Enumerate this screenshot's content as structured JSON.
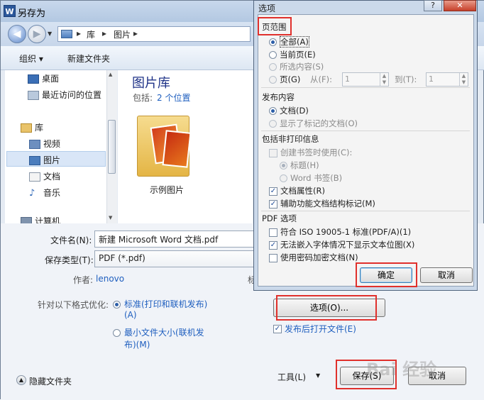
{
  "window": {
    "app_icon": "W",
    "title": "另存为"
  },
  "nav": {
    "breadcrumb": [
      "库",
      "图片"
    ]
  },
  "toolbar": {
    "organize": "组织 ▾",
    "new_folder": "新建文件夹"
  },
  "sidebar": {
    "items": [
      {
        "label": "桌面",
        "icon": "desktop-icon"
      },
      {
        "label": "最近访问的位置",
        "icon": "recent-places-icon"
      },
      {
        "label": "库",
        "icon": "library-icon"
      },
      {
        "label": "视频",
        "icon": "video-icon"
      },
      {
        "label": "图片",
        "icon": "pictures-icon"
      },
      {
        "label": "文档",
        "icon": "documents-icon"
      },
      {
        "label": "音乐",
        "icon": "music-icon"
      },
      {
        "label": "计算机",
        "icon": "computer-icon"
      }
    ]
  },
  "library": {
    "title": "图片库",
    "includes_label": "包括:",
    "includes_link": "2 个位置",
    "folder_name": "示例图片"
  },
  "form": {
    "filename_label": "文件名(N):",
    "filename_value": "新建 Microsoft Word 文档.pdf",
    "filetype_label": "保存类型(T):",
    "filetype_value": "PDF (*.pdf)",
    "author_label": "作者:",
    "author_value": "lenovo",
    "tags_label_fragment": "标",
    "optimize_label": "针对以下格式优化:",
    "optimize_standard": "标准(打印和联机发布)",
    "optimize_standard_key": "(A)",
    "optimize_min": "最小文件大小(联机发",
    "optimize_min_2": "布)(M)",
    "options_button": "选项(O)...",
    "open_after_publish": "发布后打开文件(E)",
    "hide_folders": "隐藏文件夹",
    "tools": "工具(L)",
    "save": "保存(S)",
    "cancel": "取消"
  },
  "options_dialog": {
    "title": "选项",
    "help": "?",
    "close": "✕",
    "page_range_title": "页范围",
    "all": "全部(A)",
    "current_page": "当前页(E)",
    "selection": "所选内容(S)",
    "pages": "页(G)",
    "from": "从(F):",
    "from_value": "1",
    "to": "到(T):",
    "to_value": "1",
    "publish_title": "发布内容",
    "document": "文档(D)",
    "document_markup": "显示了标记的文档(O)",
    "nonprint_title": "包括非打印信息",
    "create_bookmarks": "创建书签时使用(C):",
    "headings": "标题(H)",
    "word_bookmarks": "Word 书签(B)",
    "doc_properties": "文档属性(R)",
    "structure_tags": "辅助功能文档结构标记(M)",
    "pdf_options_title": "PDF 选项",
    "iso": "符合 ISO 19005-1 标准(PDF/A)(1)",
    "bitmap_text": "无法嵌入字体情况下显示文本位图(X)",
    "encrypt": "使用密码加密文档(N)",
    "ok": "确定",
    "cancel": "取消"
  },
  "watermark": "Bai 经验"
}
